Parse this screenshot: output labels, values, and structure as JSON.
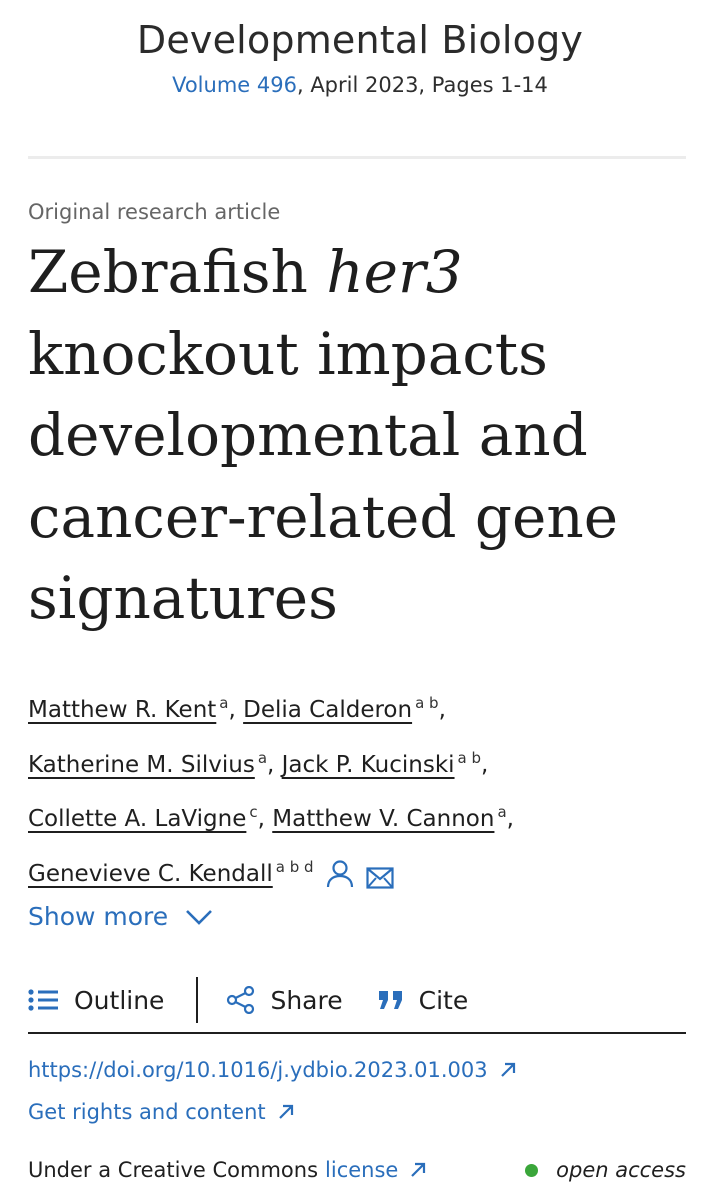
{
  "journal": {
    "name": "Developmental Biology",
    "volume_link": "Volume 496",
    "issue_rest": ", April 2023, Pages 1-14"
  },
  "article": {
    "type": "Original research article",
    "title_pre": "Zebrafish ",
    "title_gene": "her3",
    "title_post": " knockout impacts developmental and cancer-related gene signatures"
  },
  "authors": [
    {
      "name": "Matthew R. Kent",
      "aff": "a",
      "sep": ","
    },
    {
      "name": "Delia Calderon",
      "aff": "a b",
      "sep": ","
    },
    {
      "name": "Katherine M. Silvius",
      "aff": "a",
      "sep": ","
    },
    {
      "name": "Jack P. Kucinski",
      "aff": "a b",
      "sep": ","
    },
    {
      "name": "Collette A. LaVigne",
      "aff": "c",
      "sep": ","
    },
    {
      "name": "Matthew V. Cannon",
      "aff": "a",
      "sep": ","
    },
    {
      "name": "Genevieve C. Kendall",
      "aff": "a b d",
      "sep": ""
    }
  ],
  "show_more": "Show more",
  "actions": {
    "outline": "Outline",
    "share": "Share",
    "cite": "Cite"
  },
  "links": {
    "doi": "https://doi.org/10.1016/j.ydbio.2023.01.003",
    "rights": "Get rights and content"
  },
  "license": {
    "prefix": "Under a Creative Commons",
    "link": "license",
    "access": "open access"
  },
  "colors": {
    "link": "#2a6ebb",
    "open_access_dot": "#3aa63a",
    "text": "#1f1f1f"
  }
}
